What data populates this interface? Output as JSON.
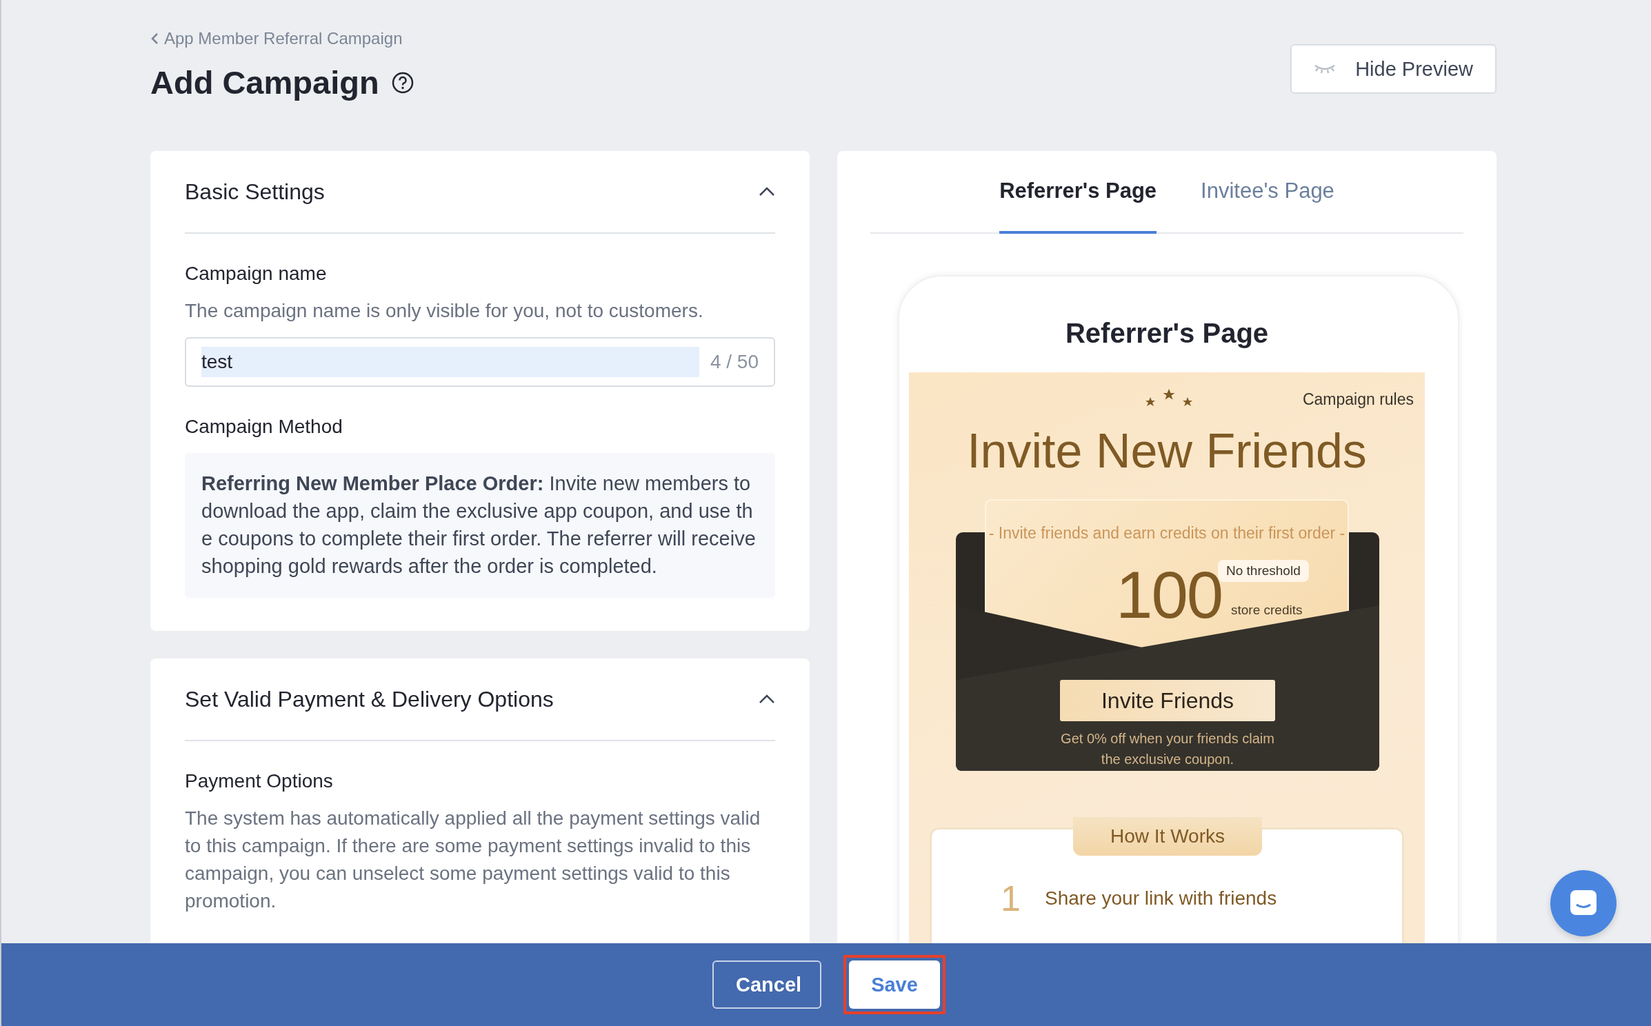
{
  "breadcrumb": {
    "label": "App Member Referral Campaign"
  },
  "page_title": "Add Campaign",
  "hide_preview_button": "Hide Preview",
  "sections": [
    {
      "title": "Basic Settings",
      "expanded": true,
      "fields": [
        {
          "kind": "input",
          "label": "Campaign name",
          "description": "The campaign name is only visible for you, not to customers.",
          "value": "test",
          "counter": "4 / 50"
        },
        {
          "kind": "info",
          "label": "Campaign Method",
          "text": "**Referring New Member Place Order:** Invite new members to download the app, claim the exclusive app coupon, and use the coupons to complete their first order. The referrer will receive shopping gold rewards after the order is completed."
        }
      ]
    },
    {
      "title": "Set Valid Payment & Delivery Options",
      "expanded": true,
      "fields": [
        {
          "kind": "text",
          "label": "Payment Options",
          "description": "The system has automatically applied all the payment settings valid to this campaign. If there are some payment settings invalid to this campaign, you can unselect some payment settings valid to this promotion."
        }
      ]
    }
  ],
  "preview": {
    "tabs": [
      {
        "label": "Referrer's Page",
        "selected": true
      },
      {
        "label": "Invitee's Page",
        "selected": false
      }
    ],
    "phone_title": "Referrer's Page",
    "campaign_rules": "Campaign rules",
    "headline": "Invite New Friends",
    "subtitle": "- Invite friends and earn credits on their first order -",
    "amount": "100",
    "badge": "No threshold",
    "unit": "store credits",
    "cta": "Invite Friends",
    "note": "Get 0% off when your friends claim the exclusive coupon.",
    "how_title": "How It Works",
    "steps": [
      {
        "number": "1",
        "text": "Share your link with friends"
      }
    ]
  },
  "footer": {
    "buttons": [
      {
        "label": "Cancel",
        "kind": "secondary",
        "highlighted": false
      },
      {
        "label": "Save",
        "kind": "primary",
        "highlighted": true
      }
    ]
  }
}
